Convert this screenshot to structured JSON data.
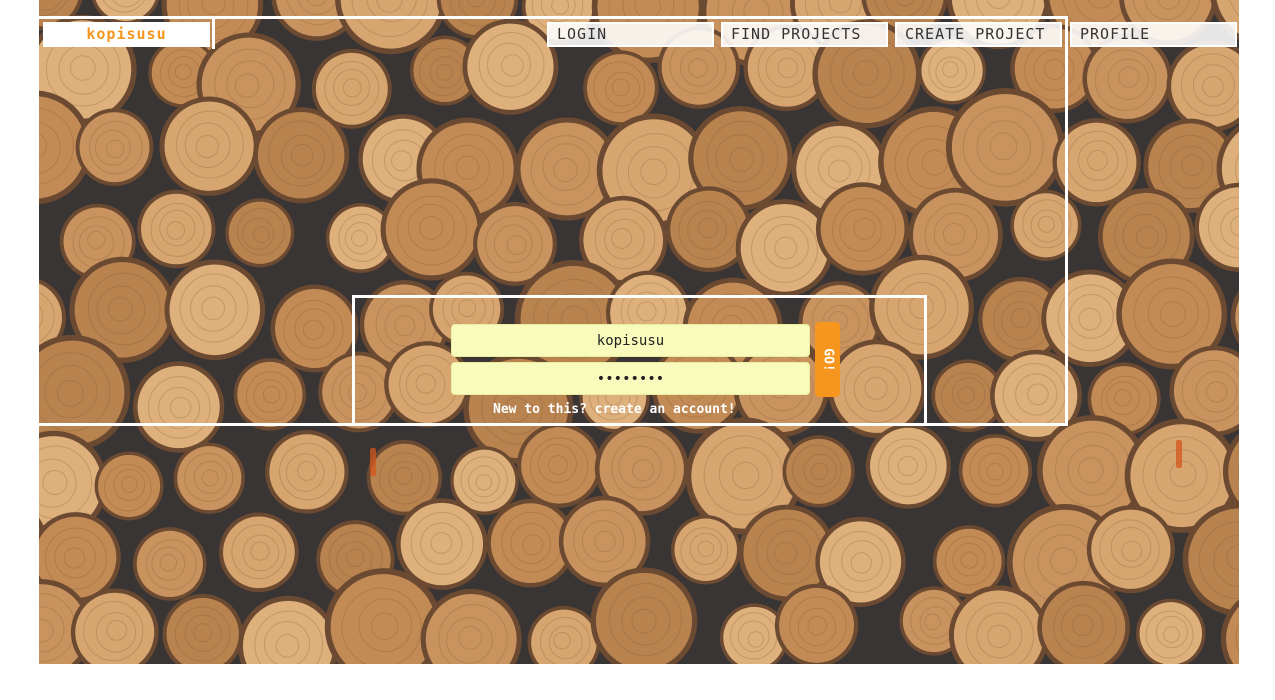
{
  "nav": {
    "brand": "kopisusu",
    "login": "LOGIN",
    "find_projects": "FIND PROJECTS",
    "create_project": "CREATE PROJECT",
    "profile": "PROFILE"
  },
  "login_form": {
    "username_value": "kopisusu",
    "password_value": "kopisusu",
    "go_label": "GO!",
    "signup_text": "New to this? create an account!"
  },
  "colors": {
    "accent": "#f6961e",
    "field_bg": "#f8fbbc",
    "frame": "#ffffff"
  }
}
